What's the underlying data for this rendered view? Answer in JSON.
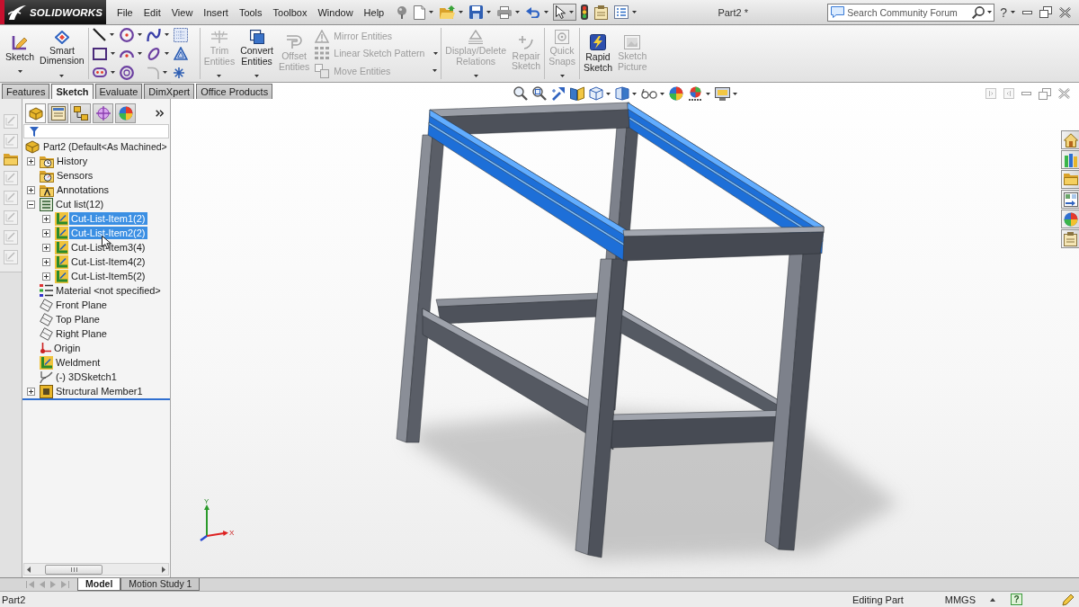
{
  "title_bar": {
    "logo": "SOLIDWORKS",
    "menu": [
      "File",
      "Edit",
      "View",
      "Insert",
      "Tools",
      "Toolbox",
      "Window",
      "Help"
    ],
    "quick_access": [
      {
        "dropdown": false,
        "pressed": false
      },
      {
        "dropdown": true,
        "pressed": false
      },
      {
        "dropdown": true,
        "pressed": false
      },
      {
        "dropdown": true,
        "pressed": false
      },
      {
        "dropdown": true,
        "pressed": false
      },
      {
        "dropdown": true,
        "pressed": false
      },
      {
        "dropdown": true,
        "pressed": true
      },
      {
        "dropdown": false,
        "pressed": false
      },
      {
        "dropdown": false,
        "pressed": false
      },
      {
        "dropdown": true,
        "pressed": false
      }
    ],
    "document_title": "Part2 *",
    "search": {
      "placeholder": "Search Community Forum"
    },
    "help": "?"
  },
  "command_manager": {
    "groups": [
      {
        "buttons": [
          {
            "kind": "large",
            "label": "Sketch",
            "disabled": false,
            "dropdown": true
          },
          {
            "kind": "large",
            "label": "Smart Dimension",
            "disabled": false,
            "dropdown": true
          }
        ]
      },
      {
        "tools": [
          {
            "dropdown": true,
            "disabled": false
          },
          {
            "dropdown": true,
            "disabled": false
          },
          {
            "dropdown": true,
            "disabled": false
          },
          {
            "dropdown": false,
            "disabled": false
          },
          {
            "dropdown": true,
            "disabled": false
          },
          {
            "dropdown": true,
            "disabled": false
          },
          {
            "dropdown": true,
            "disabled": false
          },
          {
            "dropdown": false,
            "disabled": false
          },
          {
            "dropdown": true,
            "disabled": false
          },
          {
            "dropdown": false,
            "disabled": false
          },
          {
            "dropdown": true,
            "disabled": true
          },
          {
            "dropdown": false,
            "disabled": false
          }
        ]
      },
      {
        "buttons": [
          {
            "kind": "large",
            "label": "Trim Entities",
            "disabled": true,
            "dropdown": true
          },
          {
            "kind": "large",
            "label": "Convert Entities",
            "disabled": false,
            "dropdown": true
          },
          {
            "kind": "large",
            "label": "Offset Entities",
            "disabled": true,
            "dropdown": false
          },
          {
            "kind": "small",
            "label": "Mirror Entities",
            "disabled": true,
            "dropdown": false
          },
          {
            "kind": "small",
            "label": "Linear Sketch Pattern",
            "disabled": true,
            "dropdown": true
          },
          {
            "kind": "small",
            "label": "Move Entities",
            "disabled": true,
            "dropdown": true
          }
        ]
      },
      {
        "buttons": [
          {
            "kind": "large",
            "label": "Display/Delete Relations",
            "disabled": true,
            "dropdown": true
          },
          {
            "kind": "large",
            "label": "Repair Sketch",
            "disabled": true,
            "dropdown": false
          }
        ]
      },
      {
        "buttons": [
          {
            "kind": "large",
            "label": "Quick Snaps",
            "disabled": true,
            "dropdown": true
          }
        ]
      },
      {
        "buttons": [
          {
            "kind": "large",
            "label": "Rapid Sketch",
            "disabled": false,
            "dropdown": false
          },
          {
            "kind": "large",
            "label": "Sketch Picture",
            "disabled": true,
            "dropdown": false
          }
        ]
      }
    ]
  },
  "command_tabs": [
    {
      "label": "Features",
      "selected": false
    },
    {
      "label": "Sketch",
      "selected": true
    },
    {
      "label": "Evaluate",
      "selected": false
    },
    {
      "label": "DimXpert",
      "selected": false
    },
    {
      "label": "Office Products",
      "selected": false
    }
  ],
  "side_toolbar": [
    {
      "disabled": true
    },
    {
      "disabled": true
    },
    {
      "disabled": false
    },
    {
      "disabled": true
    },
    {
      "disabled": true
    },
    {
      "disabled": true
    },
    {
      "disabled": true
    },
    {
      "disabled": true
    }
  ],
  "feature_tree": {
    "panel_tabs": [
      {
        "selected": true
      },
      {
        "selected": false
      },
      {
        "selected": false
      },
      {
        "selected": false
      },
      {
        "selected": false
      }
    ],
    "root": {
      "kind": "part",
      "label": "Part2 (Default<As Machined>",
      "selected": false
    },
    "items": [
      {
        "kind": "history",
        "label": "History",
        "expanded": false,
        "selected": false
      },
      {
        "kind": "sensors",
        "label": "Sensors",
        "selected": false
      },
      {
        "kind": "annotations",
        "label": "Annotations",
        "expanded": false,
        "selected": false
      },
      {
        "kind": "cut-list",
        "label": "Cut list(12)",
        "expanded": true,
        "selected": false,
        "children": [
          {
            "kind": "cut-item",
            "label": "Cut-List-Item1(2)",
            "expanded": false,
            "selected": true
          },
          {
            "kind": "cut-item",
            "label": "Cut-List-Item2(2)",
            "expanded": false,
            "selected": true
          },
          {
            "kind": "cut-item",
            "label": "Cut-List-Item3(4)",
            "expanded": false,
            "selected": false
          },
          {
            "kind": "cut-item",
            "label": "Cut-List-Item4(2)",
            "expanded": false,
            "selected": false
          },
          {
            "kind": "cut-item",
            "label": "Cut-List-Item5(2)",
            "expanded": false,
            "selected": false
          }
        ]
      },
      {
        "kind": "material",
        "label": "Material <not specified>",
        "selected": false
      },
      {
        "kind": "plane",
        "label": "Front Plane",
        "selected": false
      },
      {
        "kind": "plane",
        "label": "Top Plane",
        "selected": false
      },
      {
        "kind": "plane",
        "label": "Right Plane",
        "selected": false
      },
      {
        "kind": "origin",
        "label": "Origin",
        "selected": false
      },
      {
        "kind": "weldment",
        "label": "Weldment",
        "selected": false
      },
      {
        "kind": "sketch",
        "label": "(-) 3DSketch1",
        "selected": false
      },
      {
        "kind": "structural-member",
        "label": "Structural Member1",
        "expanded": false,
        "selected": false
      }
    ]
  },
  "viewport": {
    "view_toolbar": [
      {
        "dropdown": false
      },
      {
        "dropdown": false
      },
      {
        "dropdown": false
      },
      {
        "dropdown": false
      },
      {
        "dropdown": true
      },
      {
        "dropdown": true
      },
      {
        "dropdown": true
      },
      {
        "dropdown": false
      },
      {
        "dropdown": true
      },
      {
        "dropdown": true
      }
    ],
    "triad": {
      "y_label": "Y",
      "x_label": "X"
    }
  },
  "model_tabs": [
    {
      "label": "Model",
      "selected": true
    },
    {
      "label": "Motion Study 1",
      "selected": false
    }
  ],
  "status_bar": {
    "document": "Part2",
    "mode": "Editing Part",
    "units": "MMGS",
    "help": "?"
  }
}
